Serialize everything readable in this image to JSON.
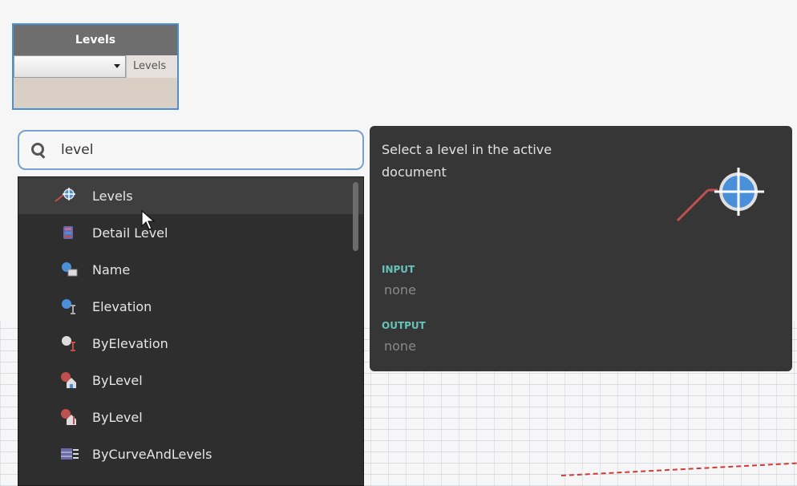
{
  "node": {
    "title": "Levels",
    "dropdown_value": "",
    "port_label": "Levels"
  },
  "search": {
    "query": "level"
  },
  "results": [
    {
      "label": "Levels",
      "icon": "level-crosshair-icon"
    },
    {
      "label": "Detail Level",
      "icon": "detail-level-icon"
    },
    {
      "label": "Name",
      "icon": "name-icon"
    },
    {
      "label": "Elevation",
      "icon": "elevation-icon"
    },
    {
      "label": "ByElevation",
      "icon": "by-elevation-icon"
    },
    {
      "label": "ByLevel",
      "icon": "by-level-icon"
    },
    {
      "label": "ByLevel",
      "icon": "by-level-alt-icon"
    },
    {
      "label": "ByCurveAndLevels",
      "icon": "by-curve-and-levels-icon"
    }
  ],
  "tooltip": {
    "description": "Select a level in the active document",
    "input_label": "INPUT",
    "input_value": "none",
    "output_label": "OUTPUT",
    "output_value": "none"
  },
  "colors": {
    "accent": "#4a90d9",
    "io_label": "#67c3b8",
    "panel": "#2e2e2e",
    "tooltip": "#363636"
  }
}
